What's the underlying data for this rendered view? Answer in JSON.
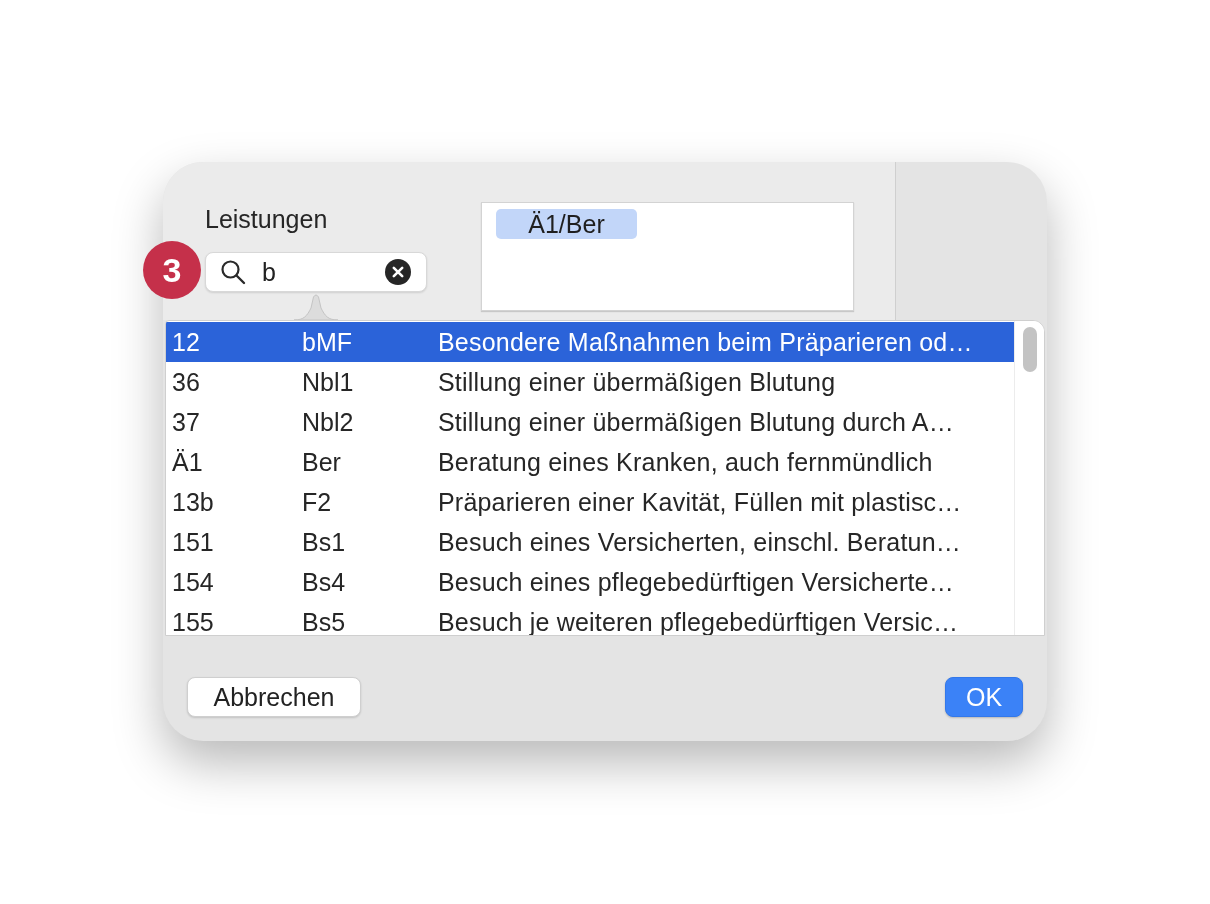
{
  "field_label": "Leistungen",
  "step_marker": "3",
  "search": {
    "value": "b"
  },
  "selected_tags": [
    {
      "label": "Ä1/Ber"
    }
  ],
  "results": [
    {
      "number": "12",
      "code": "bMF",
      "description": "Besondere Maßnahmen beim Präparieren od…",
      "selected": true
    },
    {
      "number": "36",
      "code": "Nbl1",
      "description": "Stillung einer übermäßigen Blutung",
      "selected": false
    },
    {
      "number": "37",
      "code": "Nbl2",
      "description": "Stillung einer übermäßigen Blutung durch A…",
      "selected": false
    },
    {
      "number": "Ä1",
      "code": "Ber",
      "description": "Beratung eines Kranken, auch fernmündlich",
      "selected": false
    },
    {
      "number": "13b",
      "code": "F2",
      "description": "Präparieren einer Kavität, Füllen mit plastisc…",
      "selected": false
    },
    {
      "number": "151",
      "code": "Bs1",
      "description": "Besuch eines Versicherten, einschl. Beratun…",
      "selected": false
    },
    {
      "number": "154",
      "code": "Bs4",
      "description": "Besuch eines pflegebedürftigen Versicherte…",
      "selected": false
    },
    {
      "number": "155",
      "code": "Bs5",
      "description": "Besuch je weiteren pflegebedürftigen Versic…",
      "selected": false
    }
  ],
  "buttons": [
    {
      "label": "Abbrechen",
      "kind": "secondary"
    },
    {
      "label": "OK",
      "kind": "primary"
    }
  ]
}
